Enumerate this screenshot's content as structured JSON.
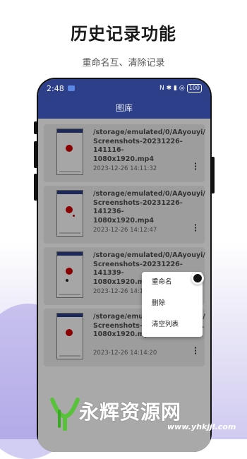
{
  "promo": {
    "title": "历史记录功能",
    "subtitle": "重命名互、清除记录"
  },
  "status_bar": {
    "time": "2:48",
    "icons_text": "N ✱ ▮ ◎",
    "battery": "100"
  },
  "app_bar": {
    "title": "图库"
  },
  "records": [
    {
      "path": "/storage/emulated/0/AAyouyi/\nScreenshots-20231226-141116-\n1080x1920.mp4",
      "date": "2023-12-26 14:11:32"
    },
    {
      "path": "/storage/emulated/0/AAyouyi/\nScreenshots-20231226-141236-\n1080x1920.mp4",
      "date": "2023-12-26 14:12:47"
    },
    {
      "path": "/storage/emulated/0/AAyouyi/\nScreenshots-20231226-141339-\n1080x1920.mp4",
      "date": "2023-12-26 14:13:..."
    },
    {
      "path": "/storage/emulated/0/AAyouyi/\nScreenshots-20231226-141...\n1080x1920.mp4",
      "date": "2023-12-26 14:14:20"
    }
  ],
  "context_menu": {
    "items": [
      "重命名",
      "删除",
      "清空列表"
    ]
  },
  "watermark": {
    "text": "永辉资源网",
    "url": "www.yhkjjl.com"
  },
  "colors": {
    "app_bar": "#2d3f88",
    "thumb_dot": "#d40000",
    "watermark_logo": "#58c23a"
  }
}
